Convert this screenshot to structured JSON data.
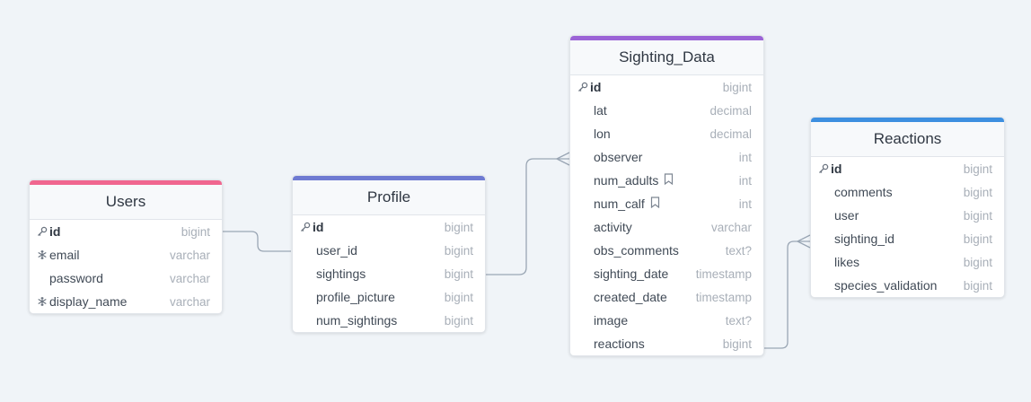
{
  "colors": {
    "users": "#f0668f",
    "profile": "#6e7ad2",
    "sighting_data": "#9b63d6",
    "reactions": "#3d8fe0",
    "connector": "#9aa6b4"
  },
  "tables": {
    "users": {
      "title": "Users",
      "fields": [
        {
          "name": "id",
          "type": "bigint",
          "icon": "key-icon"
        },
        {
          "name": "email",
          "type": "varchar",
          "icon": "snowflake-icon"
        },
        {
          "name": "password",
          "type": "varchar",
          "icon": ""
        },
        {
          "name": "display_name",
          "type": "varchar",
          "icon": "snowflake-icon"
        }
      ]
    },
    "profile": {
      "title": "Profile",
      "fields": [
        {
          "name": "id",
          "type": "bigint",
          "icon": "key-icon"
        },
        {
          "name": "user_id",
          "type": "bigint",
          "icon": ""
        },
        {
          "name": "sightings",
          "type": "bigint",
          "icon": ""
        },
        {
          "name": "profile_picture",
          "type": "bigint",
          "icon": ""
        },
        {
          "name": "num_sightings",
          "type": "bigint",
          "icon": ""
        }
      ]
    },
    "sighting_data": {
      "title": "Sighting_Data",
      "fields": [
        {
          "name": "id",
          "type": "bigint",
          "icon": "key-icon"
        },
        {
          "name": "lat",
          "type": "decimal",
          "icon": ""
        },
        {
          "name": "lon",
          "type": "decimal",
          "icon": ""
        },
        {
          "name": "observer",
          "type": "int",
          "icon": ""
        },
        {
          "name": "num_adults",
          "type": "int",
          "icon": "",
          "note": true
        },
        {
          "name": "num_calf",
          "type": "int",
          "icon": "",
          "note": true
        },
        {
          "name": "activity",
          "type": "varchar",
          "icon": ""
        },
        {
          "name": "obs_comments",
          "type": "text?",
          "icon": ""
        },
        {
          "name": "sighting_date",
          "type": "timestamp",
          "icon": ""
        },
        {
          "name": "created_date",
          "type": "timestamp",
          "icon": ""
        },
        {
          "name": "image",
          "type": "text?",
          "icon": ""
        },
        {
          "name": "reactions",
          "type": "bigint",
          "icon": ""
        }
      ]
    },
    "reactions": {
      "title": "Reactions",
      "fields": [
        {
          "name": "id",
          "type": "bigint",
          "icon": "key-icon"
        },
        {
          "name": "comments",
          "type": "bigint",
          "icon": ""
        },
        {
          "name": "user",
          "type": "bigint",
          "icon": ""
        },
        {
          "name": "sighting_id",
          "type": "bigint",
          "icon": ""
        },
        {
          "name": "likes",
          "type": "bigint",
          "icon": ""
        },
        {
          "name": "species_validation",
          "type": "bigint",
          "icon": ""
        }
      ]
    }
  }
}
